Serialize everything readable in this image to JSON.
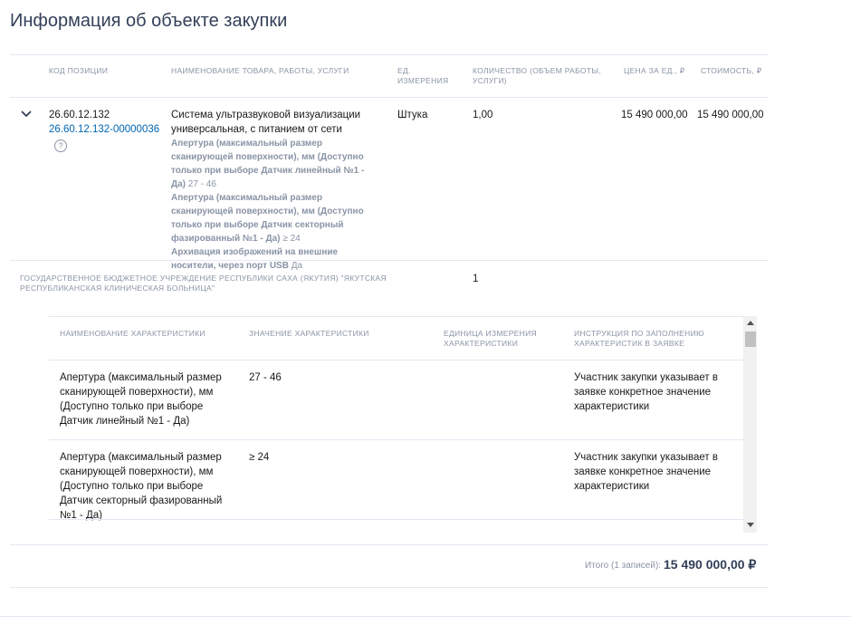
{
  "page": {
    "title": "Информация об объекте закупки"
  },
  "table": {
    "headers": {
      "code": "Код позиции",
      "name": "Наименование товара, работы, услуги",
      "unit": "Ед. измерения",
      "qty": "Количество (объем работы, услуги)",
      "price": "Цена за ед., ₽",
      "cost": "Стоимость, ₽"
    },
    "row": {
      "code1": "26.60.12.132",
      "code2": "26.60.12.132-00000036",
      "name": "Система ультразвуковой визуализации универсальная, с питанием от сети",
      "chars": [
        {
          "label": "Апертура (максимальный размер сканирующей поверхности), мм (Доступно только при выборе Датчик линейный №1 - Да)",
          "value": "27 - 46"
        },
        {
          "label": "Апертура (максимальный размер сканирующей поверхности), мм (Доступно только при выборе Датчик секторный фазированный №1 - Да)",
          "value": "≥ 24"
        },
        {
          "label": "Архивация изображений на внешние носители, через порт USB",
          "value": "Да"
        }
      ],
      "unit": "Штука",
      "qty": "1,00",
      "price": "15 490 000,00",
      "cost": "15 490 000,00"
    },
    "org": {
      "name": "Государственное бюджетное учреждение Республики Саха (Якутия) \"Якутская республиканская клиническая больница\"",
      "qty": "1"
    }
  },
  "inner_table": {
    "headers": {
      "name": "Наименование характеристики",
      "value": "Значение характеристики",
      "unit": "Единица измерения характеристики",
      "instruction": "Инструкция по заполнению характеристик в заявке"
    },
    "rows": [
      {
        "name": "Апертура (максимальный размер сканирующей поверхности), мм (Доступно только при выборе Датчик линейный №1 - Да)",
        "value": "27 - 46",
        "unit": "",
        "instruction": "Участник закупки указывает в заявке конкретное значение характеристики"
      },
      {
        "name": "Апертура (максимальный размер сканирующей поверхности), мм (Доступно только при выборе Датчик секторный фазированный №1 - Да)",
        "value": "≥ 24",
        "unit": "",
        "instruction": "Участник закупки указывает в заявке конкретное значение характеристики"
      }
    ]
  },
  "total": {
    "label": "Итого (1 записей):",
    "value": "15 490 000,00 ₽"
  }
}
